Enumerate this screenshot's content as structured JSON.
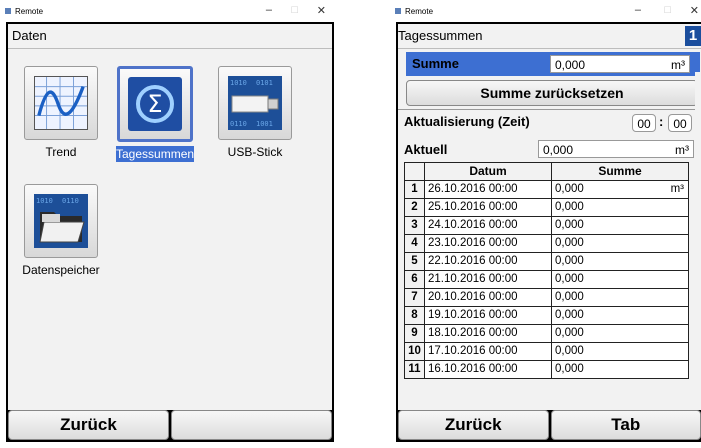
{
  "left_window": {
    "title": "Remote",
    "header": "Daten",
    "tiles": [
      {
        "label": "Trend",
        "icon": "trend-chart-icon",
        "selected": false
      },
      {
        "label": "Tagessummen",
        "icon": "sigma-icon",
        "selected": true
      },
      {
        "label": "USB-Stick",
        "icon": "usb-stick-icon",
        "selected": false
      },
      {
        "label": "Datenspeicher",
        "icon": "data-memory-folder-icon",
        "selected": false
      }
    ],
    "footer": {
      "left": "Zurück",
      "right": ""
    }
  },
  "right_window": {
    "title": "Remote",
    "header": "Tagessummen",
    "page_number": "1",
    "summe": {
      "label": "Summe",
      "value": "0,000",
      "unit": "m³"
    },
    "reset_button": "Summe zurücksetzen",
    "update": {
      "label": "Aktualisierung (Zeit)",
      "hours": "00",
      "sep": ":",
      "minutes": "00"
    },
    "aktuell": {
      "label": "Aktuell",
      "value": "0,000",
      "unit": "m³"
    },
    "table": {
      "headers": [
        "",
        "Datum",
        "Summe"
      ],
      "unit": "m³",
      "rows": [
        {
          "n": "1",
          "datum": "26.10.2016 00:00",
          "summe": "0,000"
        },
        {
          "n": "2",
          "datum": "25.10.2016 00:00",
          "summe": "0,000"
        },
        {
          "n": "3",
          "datum": "24.10.2016 00:00",
          "summe": "0,000"
        },
        {
          "n": "4",
          "datum": "23.10.2016 00:00",
          "summe": "0,000"
        },
        {
          "n": "5",
          "datum": "22.10.2016 00:00",
          "summe": "0,000"
        },
        {
          "n": "6",
          "datum": "21.10.2016 00:00",
          "summe": "0,000"
        },
        {
          "n": "7",
          "datum": "20.10.2016 00:00",
          "summe": "0,000"
        },
        {
          "n": "8",
          "datum": "19.10.2016 00:00",
          "summe": "0,000"
        },
        {
          "n": "9",
          "datum": "18.10.2016 00:00",
          "summe": "0,000"
        },
        {
          "n": "10",
          "datum": "17.10.2016 00:00",
          "summe": "0,000"
        },
        {
          "n": "11",
          "datum": "16.10.2016 00:00",
          "summe": "0,000"
        }
      ]
    },
    "footer": {
      "left": "Zurück",
      "right": "Tab"
    }
  },
  "colors": {
    "selection": "#3d6fd2",
    "panel": "#f2f2f2",
    "frame": "#000000"
  }
}
